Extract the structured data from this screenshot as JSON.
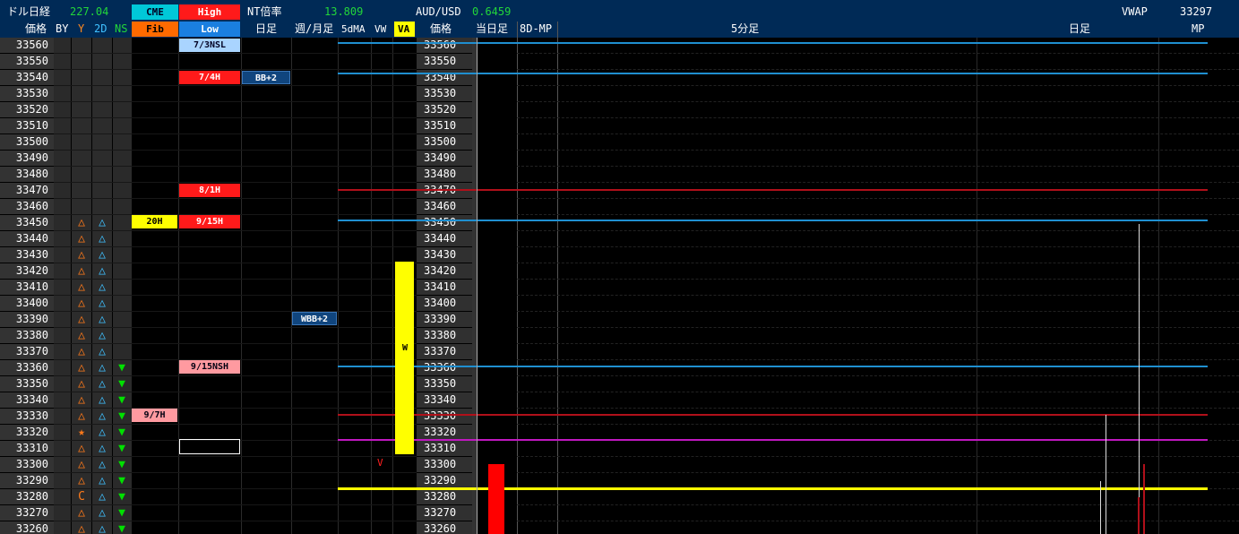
{
  "header": {
    "nikkei_label": "ドル日経",
    "nikkei_value": "227.04",
    "cme_label": "CME",
    "high_label": "High",
    "fib_label": "Fib",
    "low_label": "Low",
    "nt_label": "NT倍率",
    "nt_value": "13.809",
    "audusd_label": "AUD/USD",
    "audusd_value": "0.6459",
    "vwap_label": "VWAP",
    "vwap_value": "33297"
  },
  "columns": {
    "price": "価格",
    "by": "BY",
    "y": "Y",
    "2d": "2D",
    "ns": "NS",
    "daily": "日足",
    "weekly_monthly": "週/月足",
    "ma5": "5dMA",
    "vw": "VW",
    "va": "VA",
    "price2": "価格",
    "today_daily": "当日足",
    "mp8d": "8D-MP",
    "min5": "5分足",
    "daily2": "日足",
    "mp": "MP"
  },
  "prices": [
    "33560",
    "33550",
    "33540",
    "33530",
    "33520",
    "33510",
    "33500",
    "33490",
    "33480",
    "33470",
    "33460",
    "33450",
    "33440",
    "33430",
    "33420",
    "33410",
    "33400",
    "33390",
    "33380",
    "33370",
    "33360",
    "33350",
    "33340",
    "33330",
    "33320",
    "33310",
    "33300",
    "33290",
    "33280",
    "33270",
    "33260"
  ],
  "tags": {
    "t73nsl": "7/3NSL",
    "t74h": "7/4H",
    "bb2": "BB+2",
    "t81h": "8/1H",
    "t20h": "20H",
    "t915h": "9/15H",
    "wbb2": "WBB+2",
    "t915nsh": "9/15NSH",
    "t97h": "9/7H",
    "w_marker": "W",
    "v_marker": "V"
  },
  "symbols": {
    "triangle": "△",
    "star": "★",
    "c": "C",
    "down": "▼"
  },
  "colors": {
    "header_bg": "#002a56",
    "cyan_line": "#1f8fd0",
    "red_line": "#b0101a",
    "magenta_line": "#c018c0",
    "yellow": "#ffff00",
    "orange": "#ff6a00",
    "green": "#00e000",
    "red_tag": "#ff1a1a",
    "pink_tag": "#ff9aa0"
  }
}
